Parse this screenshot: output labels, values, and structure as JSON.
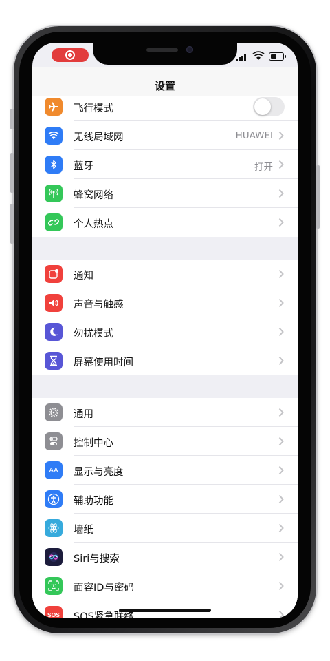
{
  "nav": {
    "title": "设置"
  },
  "status": {
    "location_icon": "screen-recording-icon"
  },
  "colors": {
    "airplane": "#f08a2d",
    "wifi": "#2f7cf6",
    "bluetooth": "#2f7cf6",
    "cellular": "#34c759",
    "hotspot": "#34c759",
    "notifications": "#f0413c",
    "sounds": "#f0413c",
    "dnd": "#5856d6",
    "screentime": "#5856d6",
    "general": "#8e8e93",
    "control": "#8e8e93",
    "display": "#2f7cf6",
    "accessibility": "#2f7cf6",
    "wallpaper": "#36aadc",
    "siri": "#1c1c3c",
    "faceid": "#34c759",
    "sos": "#f0413c"
  },
  "groups": [
    {
      "items": [
        {
          "label": "飞行模式",
          "icon": "airplane-icon",
          "control": "toggle",
          "toggle_on": false
        },
        {
          "label": "无线局域网",
          "icon": "wifi-icon",
          "value": "HUAWEI"
        },
        {
          "label": "蓝牙",
          "icon": "bluetooth-icon",
          "value": "打开"
        },
        {
          "label": "蜂窝网络",
          "icon": "cellular-icon",
          "value": ""
        },
        {
          "label": "个人热点",
          "icon": "hotspot-icon",
          "value": ""
        }
      ]
    },
    {
      "items": [
        {
          "label": "通知",
          "icon": "notifications-icon"
        },
        {
          "label": "声音与触感",
          "icon": "speaker-icon"
        },
        {
          "label": "勿扰模式",
          "icon": "moon-icon"
        },
        {
          "label": "屏幕使用时间",
          "icon": "hourglass-icon"
        }
      ]
    },
    {
      "items": [
        {
          "label": "通用",
          "icon": "gear-icon"
        },
        {
          "label": "控制中心",
          "icon": "toggles-icon"
        },
        {
          "label": "显示与亮度",
          "icon": "text-size-icon",
          "icon_text": "AA"
        },
        {
          "label": "辅助功能",
          "icon": "accessibility-icon"
        },
        {
          "label": "墙纸",
          "icon": "flower-icon"
        },
        {
          "label": "Siri与搜索",
          "icon": "siri-icon"
        },
        {
          "label": "面容ID与密码",
          "icon": "face-id-icon"
        },
        {
          "label": "SOS紧急联络",
          "icon": "sos-icon",
          "icon_text": "SOS"
        }
      ]
    }
  ]
}
